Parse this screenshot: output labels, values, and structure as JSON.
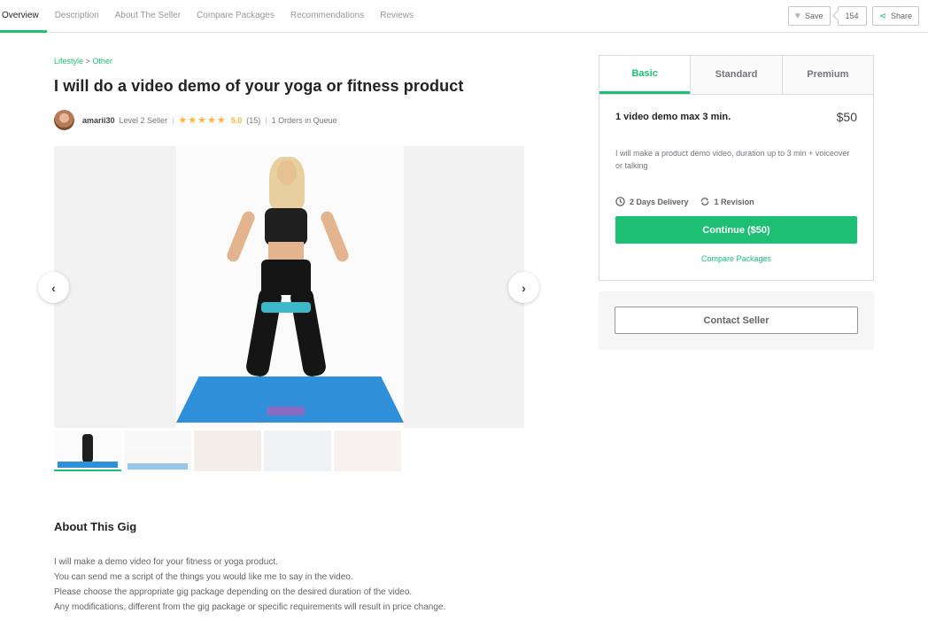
{
  "nav": {
    "tabs": [
      "Overview",
      "Description",
      "About The Seller",
      "Compare Packages",
      "Recommendations",
      "Reviews"
    ],
    "save_label": "Save",
    "save_count": "154",
    "share_label": "Share"
  },
  "breadcrumb": {
    "category": "Lifestyle",
    "separator": ">",
    "subcategory": "Other"
  },
  "gig": {
    "title": "I will do a video demo of your yoga or fitness product",
    "seller_name": "amarii30",
    "seller_level": "Level 2 Seller",
    "stars": "★★★★★",
    "rating": "5.0",
    "review_count": "(15)",
    "queue": "1 Orders in Queue"
  },
  "about": {
    "title": "About This Gig",
    "lines": [
      "I will make a demo video for your fitness or yoga product.",
      "You can send me a script of the things you would like me to say in the video.",
      "Please choose the appropriate gig package depending on the desired duration of the video.",
      "Any modifications, different from the gig package or specific requirements will result in price change."
    ]
  },
  "package": {
    "tabs": [
      "Basic",
      "Standard",
      "Premium"
    ],
    "name": "1 video demo max 3 min.",
    "price": "$50",
    "description": "I will make a product demo video, duration up to 3 min + voiceover or talking",
    "delivery": "2 Days Delivery",
    "revisions": "1 Revision",
    "continue_label": "Continue ($50)",
    "compare_label": "Compare Packages"
  },
  "contact": {
    "label": "Contact Seller"
  },
  "colors": {
    "accent": "#1dbf73",
    "star": "#ffb33e"
  }
}
